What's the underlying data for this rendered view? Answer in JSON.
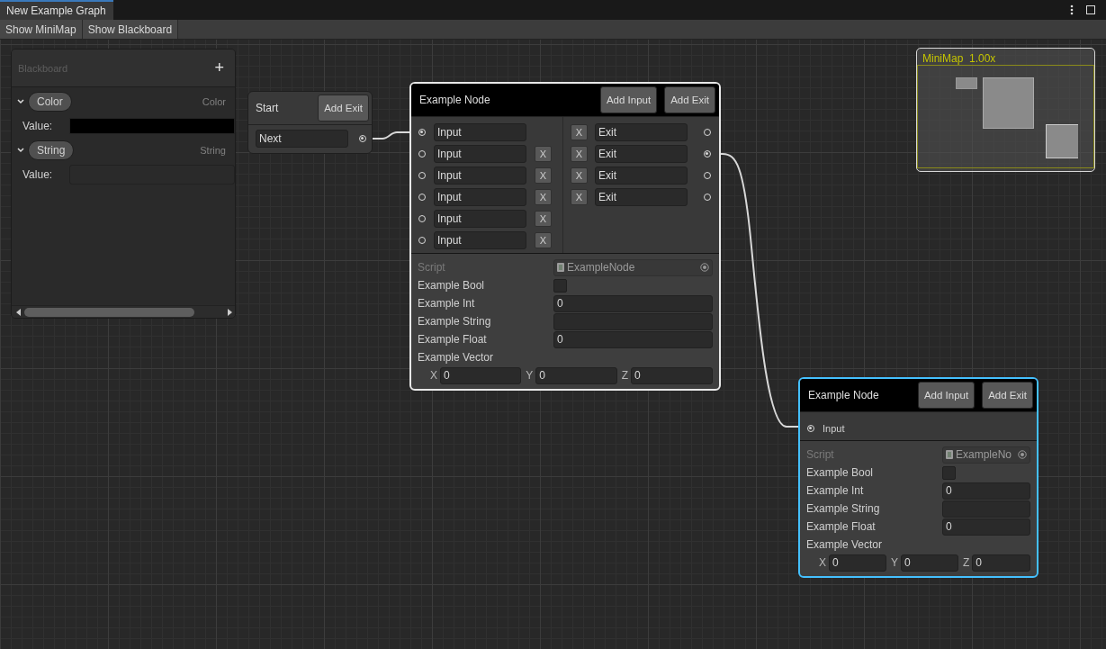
{
  "window": {
    "tab_title": "New Example Graph"
  },
  "toolbar": [
    "Show MiniMap",
    "Show Blackboard"
  ],
  "blackboard": {
    "title": "Blackboard",
    "add": "+",
    "properties": [
      {
        "name": "Color",
        "type": "Color",
        "expanded": true,
        "value_label": "Value:",
        "kind": "color",
        "color": "#000000"
      },
      {
        "name": "String",
        "type": "String",
        "expanded": true,
        "value_label": "Value:",
        "kind": "text"
      }
    ]
  },
  "start_node": {
    "title": "Start",
    "button": "Add Exit",
    "exits": [
      {
        "value": "Next",
        "connected": true
      }
    ]
  },
  "nodes": [
    {
      "title": "Example Node",
      "selected": false,
      "hovered": true,
      "buttons": [
        "Add Input",
        "Add Exit"
      ],
      "inputs": [
        {
          "kind": "field",
          "value": "Input",
          "connected": true
        },
        {
          "kind": "field",
          "value": "Input",
          "connected": false,
          "remove": "X"
        },
        {
          "kind": "field",
          "value": "Input",
          "connected": false,
          "remove": "X"
        },
        {
          "kind": "field",
          "value": "Input",
          "connected": false,
          "remove": "X"
        },
        {
          "kind": "field",
          "value": "Input",
          "connected": false,
          "remove": "X"
        },
        {
          "kind": "field",
          "value": "Input",
          "connected": false,
          "remove": "X"
        }
      ],
      "outputs": [
        {
          "value": "Exit",
          "connected": false,
          "remove": "X"
        },
        {
          "value": "Exit",
          "connected": true,
          "remove": "X"
        },
        {
          "value": "Exit",
          "connected": false,
          "remove": "X"
        },
        {
          "value": "Exit",
          "connected": false,
          "remove": "X"
        }
      ],
      "fields": [
        {
          "label": "Script",
          "kind": "object",
          "value": "ExampleNode",
          "disabled": true
        },
        {
          "label": "Example Bool",
          "kind": "checkbox",
          "checked": false
        },
        {
          "label": "Example Int",
          "kind": "text",
          "value": "0"
        },
        {
          "label": "Example String",
          "kind": "text"
        },
        {
          "label": "Example Float",
          "kind": "text",
          "value": "0"
        },
        {
          "label": "Example Vector",
          "kind": "vector",
          "components": [
            {
              "axis": "X",
              "value": "0"
            },
            {
              "axis": "Y",
              "value": "0"
            },
            {
              "axis": "Z",
              "value": "0"
            }
          ]
        }
      ]
    },
    {
      "title": "Example Node",
      "selected": true,
      "hovered": false,
      "buttons": [
        "Add Input",
        "Add Exit"
      ],
      "inputs": [
        {
          "kind": "label",
          "value": "Input",
          "connected": true
        }
      ],
      "fields": [
        {
          "label": "Script",
          "kind": "object",
          "value": "ExampleNo",
          "disabled": true
        },
        {
          "label": "Example Bool",
          "kind": "checkbox",
          "checked": false
        },
        {
          "label": "Example Int",
          "kind": "text",
          "value": "0"
        },
        {
          "label": "Example String",
          "kind": "text"
        },
        {
          "label": "Example Float",
          "kind": "text",
          "value": "0"
        },
        {
          "label": "Example Vector",
          "kind": "vector",
          "components": [
            {
              "axis": "X",
              "value": "0"
            },
            {
              "axis": "Y",
              "value": "0"
            },
            {
              "axis": "Z",
              "value": "0"
            }
          ]
        }
      ]
    }
  ],
  "minimap": {
    "title": "MiniMap",
    "zoom": "1.00x"
  }
}
